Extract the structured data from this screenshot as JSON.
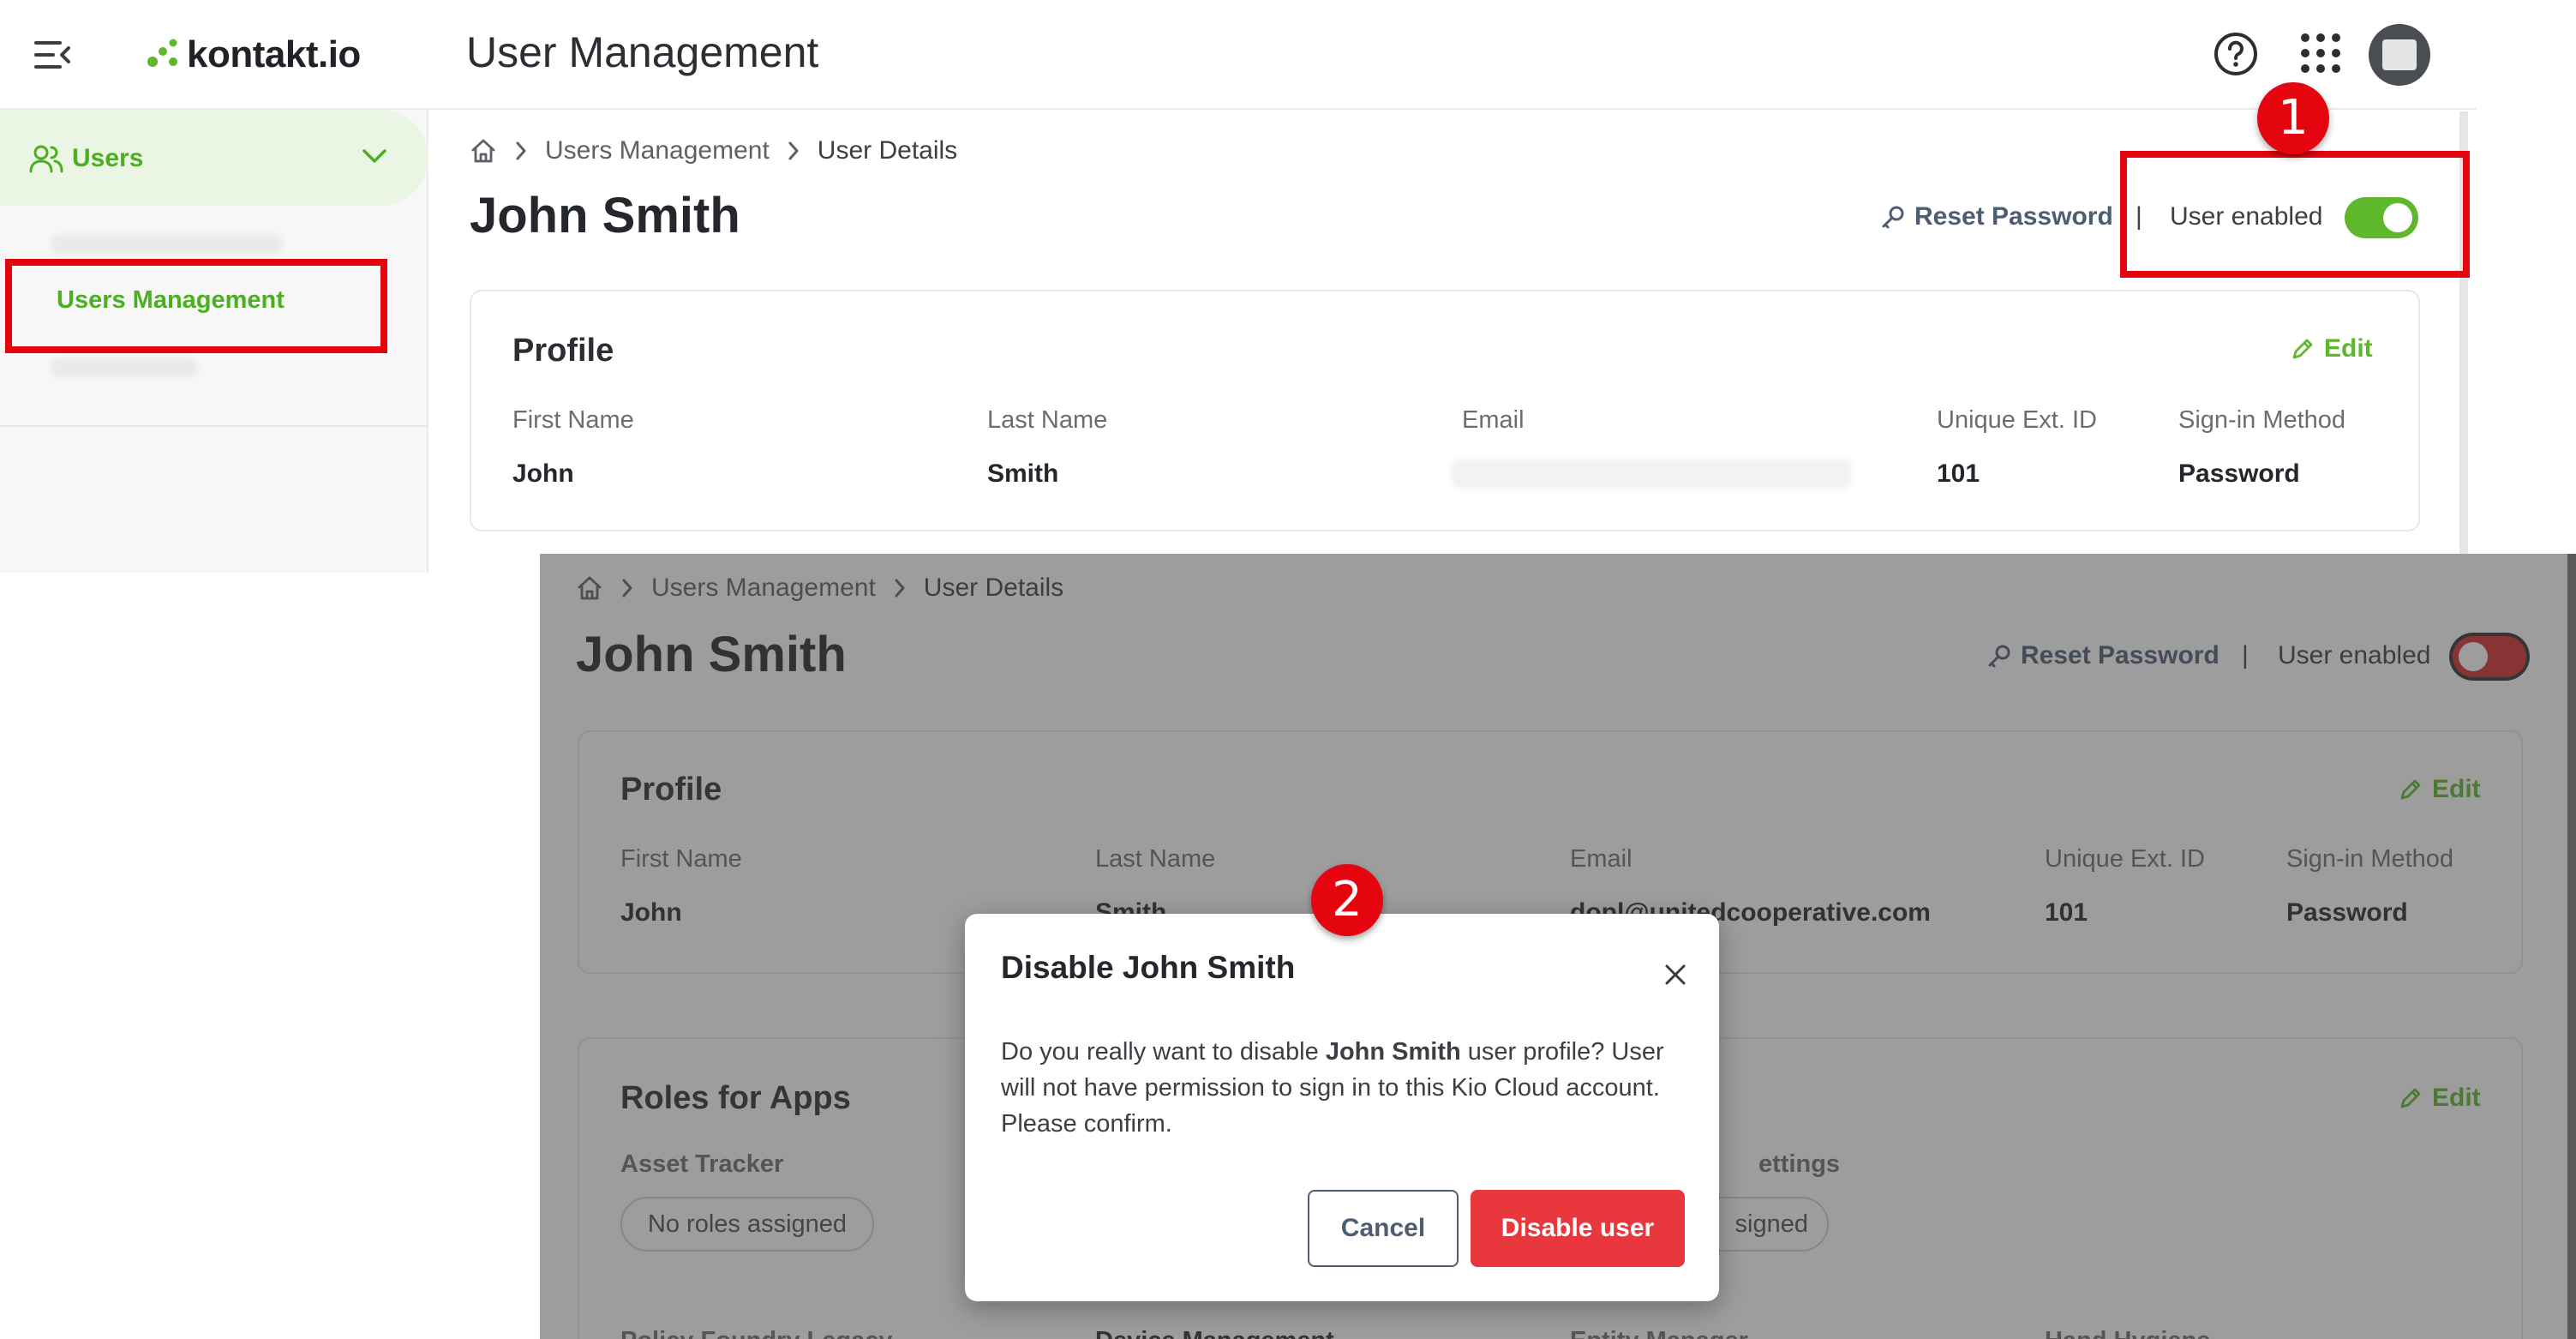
{
  "header": {
    "brand": "kontakt.io",
    "title": "User Management"
  },
  "sidebar": {
    "section_label": "Users",
    "active_item": "Users Management"
  },
  "page": {
    "breadcrumb": [
      "Users Management",
      "User Details"
    ],
    "title": "John Smith",
    "reset_password": "Reset Password",
    "separator": "|",
    "user_enabled_label": "User enabled",
    "profile_card": {
      "title": "Profile",
      "edit": "Edit",
      "columns": [
        {
          "label": "First Name",
          "value": "John"
        },
        {
          "label": "Last Name",
          "value": "Smith"
        },
        {
          "label": "Email",
          "value": ""
        },
        {
          "label": "Unique Ext. ID",
          "value": "101"
        },
        {
          "label": "Sign-in Method",
          "value": "Password"
        }
      ]
    }
  },
  "shot2": {
    "breadcrumb": [
      "Users Management",
      "User Details"
    ],
    "title": "John Smith",
    "reset_password": "Reset Password",
    "separator": "|",
    "user_enabled_label": "User enabled",
    "profile_card": {
      "title": "Profile",
      "edit": "Edit",
      "columns": [
        {
          "label": "First Name",
          "value": "John"
        },
        {
          "label": "Last Name",
          "value": "Smith"
        },
        {
          "label": "Email",
          "value": "dopl@unitedcooperative.com"
        },
        {
          "label": "Unique Ext. ID",
          "value": "101"
        },
        {
          "label": "Sign-in Method",
          "value": "Password"
        }
      ]
    },
    "roles_card": {
      "title": "Roles for Apps",
      "edit": "Edit",
      "asset_tracker": "Asset Tracker",
      "asset_tracker_chip": "No roles assigned",
      "partial_label": "ettings",
      "partial_chip": "signed",
      "bottom_apps": [
        "Policy Foundry Legacy",
        "Device Management",
        "Entity Manager",
        "Hand Hygiene"
      ]
    },
    "dialog": {
      "title": "Disable John Smith",
      "text_pre": "Do you really want to disable ",
      "text_name": "John Smith",
      "text_post": " user profile? User will not have permission to sign in to this Kio Cloud account. Please confirm.",
      "cancel": "Cancel",
      "confirm": "Disable user"
    }
  },
  "annotations": {
    "step1": "1",
    "step2": "2"
  },
  "colors": {
    "brand_green": "#5fb72c",
    "toggle_on": "#5fb72c",
    "toggle_off": "#d62c2c",
    "annotation_red": "#e4050f",
    "danger": "#e8383d"
  }
}
